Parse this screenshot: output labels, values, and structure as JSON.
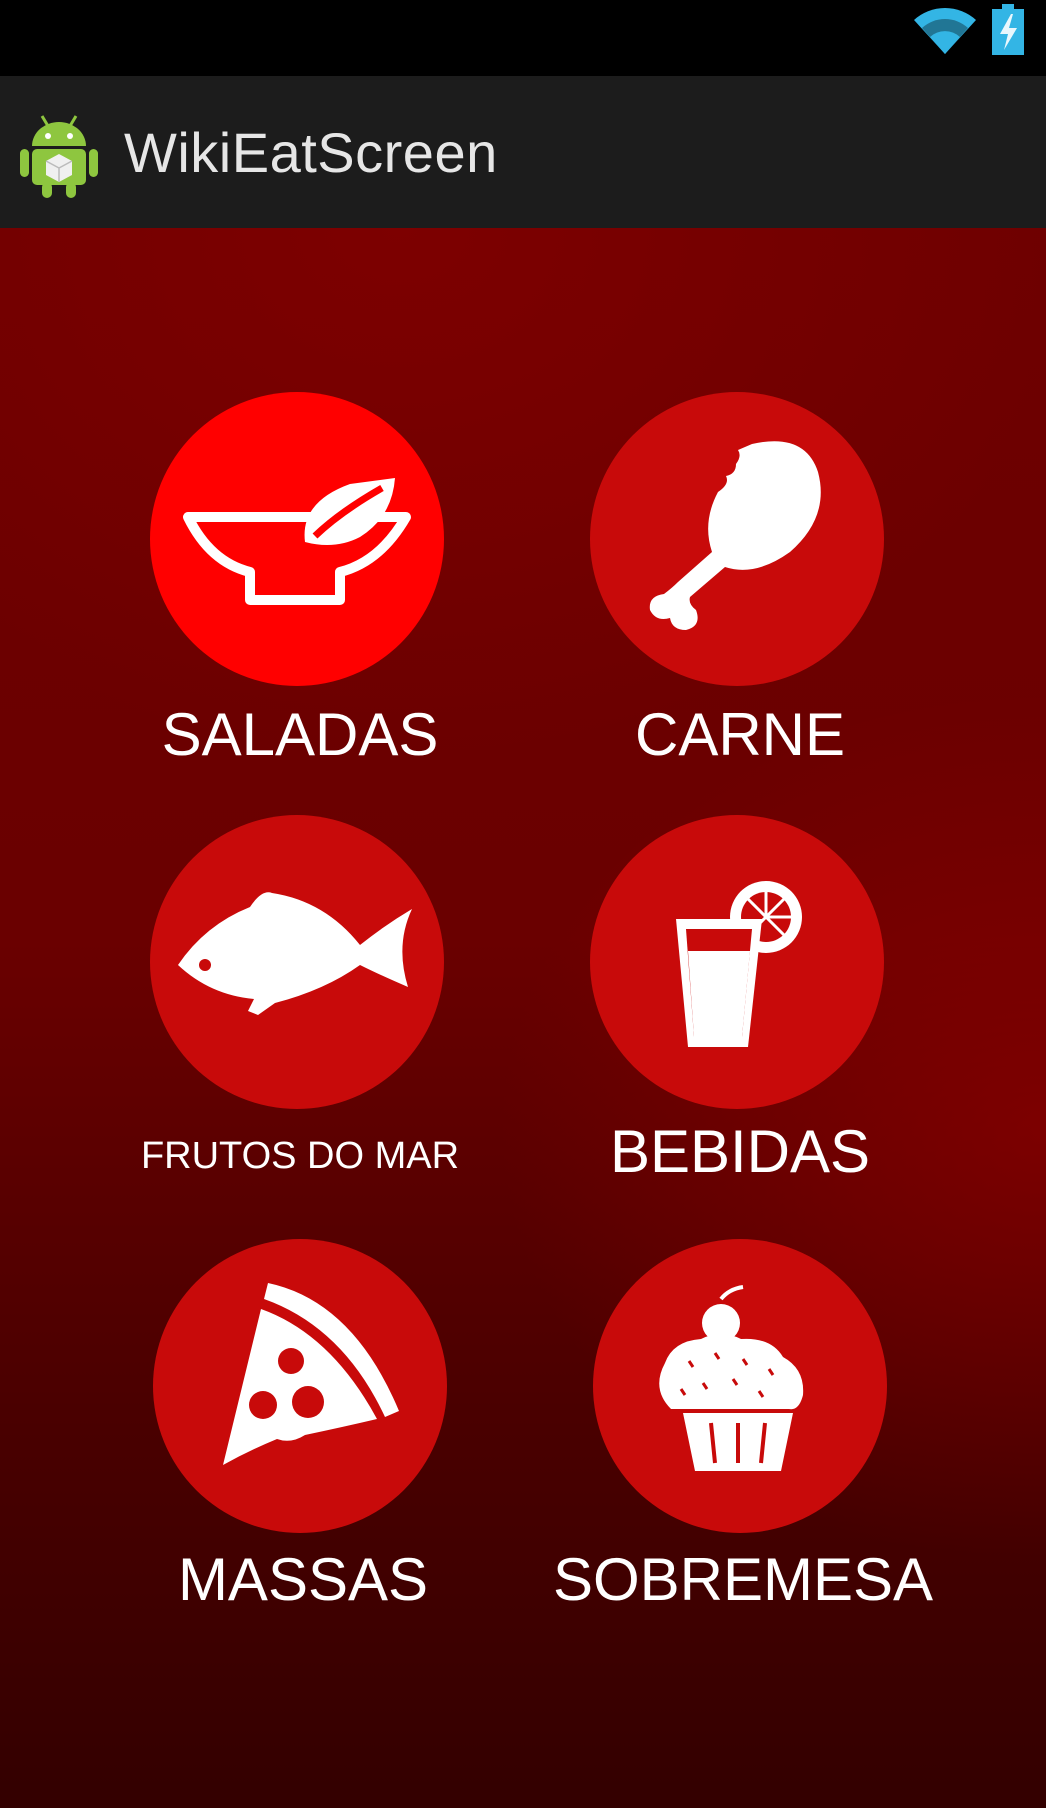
{
  "app": {
    "title": "WikiEatScreen"
  },
  "status_bar": {
    "icons": [
      "wifi-icon",
      "battery-charging-icon"
    ]
  },
  "categories": [
    {
      "label": "SALADAS",
      "icon": "salad-bowl-icon"
    },
    {
      "label": "CARNE",
      "icon": "chicken-leg-icon"
    },
    {
      "label": "FRUTOS DO MAR",
      "icon": "fish-icon"
    },
    {
      "label": "BEBIDAS",
      "icon": "drink-icon"
    },
    {
      "label": "MASSAS",
      "icon": "pizza-slice-icon"
    },
    {
      "label": "SOBREMESA",
      "icon": "cupcake-icon"
    }
  ],
  "colors": {
    "circle": "#c80a0a",
    "circle_selected": "#ff0000",
    "background": "#6e0000",
    "action_bar": "#1c1c1c",
    "label": "#ffffff"
  }
}
